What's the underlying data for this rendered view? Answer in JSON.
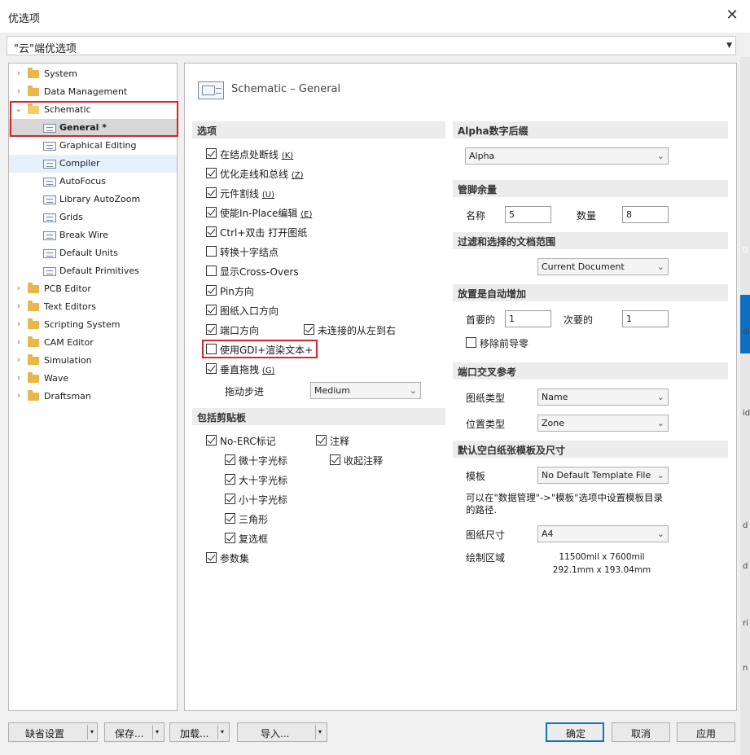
{
  "window": {
    "title": "优选项",
    "close_glyph": "✕"
  },
  "profile": {
    "value": "\"云\"端优选项"
  },
  "edge_glyphs": [
    "D",
    "ol",
    "id",
    "d",
    "d",
    "ri",
    "n"
  ],
  "tree": {
    "items": [
      {
        "label": "System",
        "level": 0
      },
      {
        "label": "Data Management",
        "level": 0
      },
      {
        "label": "Schematic",
        "level": 0,
        "expanded": true
      },
      {
        "label": "General *",
        "level": 1,
        "selected": true
      },
      {
        "label": "Graphical Editing",
        "level": 1
      },
      {
        "label": "Compiler",
        "level": 1
      },
      {
        "label": "AutoFocus",
        "level": 1
      },
      {
        "label": "Library AutoZoom",
        "level": 1
      },
      {
        "label": "Grids",
        "level": 1
      },
      {
        "label": "Break Wire",
        "level": 1
      },
      {
        "label": "Default Units",
        "level": 1
      },
      {
        "label": "Default Primitives",
        "level": 1
      },
      {
        "label": "PCB Editor",
        "level": 0
      },
      {
        "label": "Text Editors",
        "level": 0
      },
      {
        "label": "Scripting System",
        "level": 0
      },
      {
        "label": "CAM Editor",
        "level": 0
      },
      {
        "label": "Simulation",
        "level": 0
      },
      {
        "label": "Wave",
        "level": 0
      },
      {
        "label": "Draftsman",
        "level": 0
      }
    ]
  },
  "main": {
    "header_title": "Schematic – General",
    "options": {
      "section_title": "选项",
      "items": [
        {
          "label": "在结点处断线",
          "key": "(K)",
          "checked": true
        },
        {
          "label": "优化走线和总线",
          "key": "(Z)",
          "checked": true
        },
        {
          "label": "元件割线",
          "key": "(U)",
          "checked": true
        },
        {
          "label": "使能In-Place编辑",
          "key": "(E)",
          "checked": true
        },
        {
          "label": "Ctrl+双击 打开图纸",
          "key": "",
          "checked": true
        },
        {
          "label": "转换十字结点",
          "key": "",
          "checked": false
        },
        {
          "label": "显示Cross-Overs",
          "key": "",
          "checked": false
        },
        {
          "label": "Pin方向",
          "key": "",
          "checked": true
        },
        {
          "label": "图纸入口方向",
          "key": "",
          "checked": true
        },
        {
          "label": "端口方向",
          "key": "",
          "checked": true
        },
        {
          "label": "使用GDI+渲染文本+",
          "key": "",
          "checked": false
        },
        {
          "label": "垂直拖拽",
          "key": "(G)",
          "checked": true
        }
      ],
      "unconnected": {
        "label": "未连接的从左到右",
        "checked": true
      },
      "drag_step": {
        "label": "拖动步进",
        "value": "Medium"
      }
    },
    "clipboard": {
      "section_title": "包括剪贴板",
      "no_erc": {
        "label": "No-ERC标记",
        "checked": true
      },
      "sub_items": [
        {
          "label": "微十字光标",
          "checked": true
        },
        {
          "label": "大十字光标",
          "checked": true
        },
        {
          "label": "小十字光标",
          "checked": true
        },
        {
          "label": "三角形",
          "checked": true
        },
        {
          "label": "复选框",
          "checked": true
        }
      ],
      "notes": {
        "label": "注释",
        "checked": true
      },
      "collapsed_notes": {
        "label": "收起注释",
        "checked": true
      },
      "params": {
        "label": "参数集",
        "checked": true
      }
    },
    "alpha": {
      "section_title": "Alpha数字后缀",
      "value": "Alpha"
    },
    "pin_margin": {
      "section_title": "管脚余量",
      "name_label": "名称",
      "name_value": "5",
      "count_label": "数量",
      "count_value": "8"
    },
    "filter_scope": {
      "section_title": "过滤和选择的文档范围",
      "value": "Current Document"
    },
    "auto_increment": {
      "section_title": "放置是自动增加",
      "primary_label": "首要的",
      "primary_value": "1",
      "secondary_label": "次要的",
      "secondary_value": "1",
      "remove_zeros": {
        "label": "移除前导零",
        "checked": false
      }
    },
    "port_cross_ref": {
      "section_title": "端口交叉参考",
      "sheet_type_label": "图纸类型",
      "sheet_type_value": "Name",
      "position_type_label": "位置类型",
      "position_type_value": "Zone"
    },
    "template": {
      "section_title": "默认空白纸张模板及尺寸",
      "template_label": "模板",
      "template_value": "No Default Template File",
      "note": "可以在\"数据管理\"->\"模板\"选项中设置模板目录的路径.",
      "size_label": "图纸尺寸",
      "size_value": "A4",
      "area_label": "绘制区域",
      "area_mil": "11500mil x 7600mil",
      "area_mm": "292.1mm x 193.04mm"
    }
  },
  "footer": {
    "defaults": "缺省设置",
    "save": "保存...",
    "load": "加载...",
    "import": "导入...",
    "ok": "确定",
    "cancel": "取消",
    "apply": "应用",
    "split_arrow": "▾"
  }
}
